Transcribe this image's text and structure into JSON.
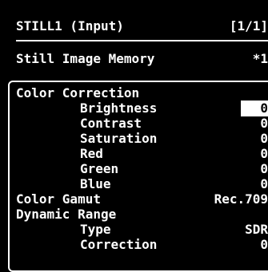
{
  "header": {
    "title": "STILL1 (Input)",
    "page": "[1/1]"
  },
  "memory": {
    "label": "Still Image Memory",
    "value": "*1"
  },
  "menu": {
    "color_correction": {
      "label": "Color Correction",
      "brightness": {
        "label": "Brightness",
        "value": "0"
      },
      "contrast": {
        "label": "Contrast",
        "value": "0"
      },
      "saturation": {
        "label": "Saturation",
        "value": "0"
      },
      "red": {
        "label": "Red",
        "value": "0"
      },
      "green": {
        "label": "Green",
        "value": "0"
      },
      "blue": {
        "label": "Blue",
        "value": "0"
      }
    },
    "color_gamut": {
      "label": "Color Gamut",
      "value": "Rec.709"
    },
    "dynamic_range": {
      "label": "Dynamic Range",
      "type": {
        "label": "Type",
        "value": "SDR"
      },
      "correction": {
        "label": "Correction",
        "value": "0"
      }
    }
  }
}
